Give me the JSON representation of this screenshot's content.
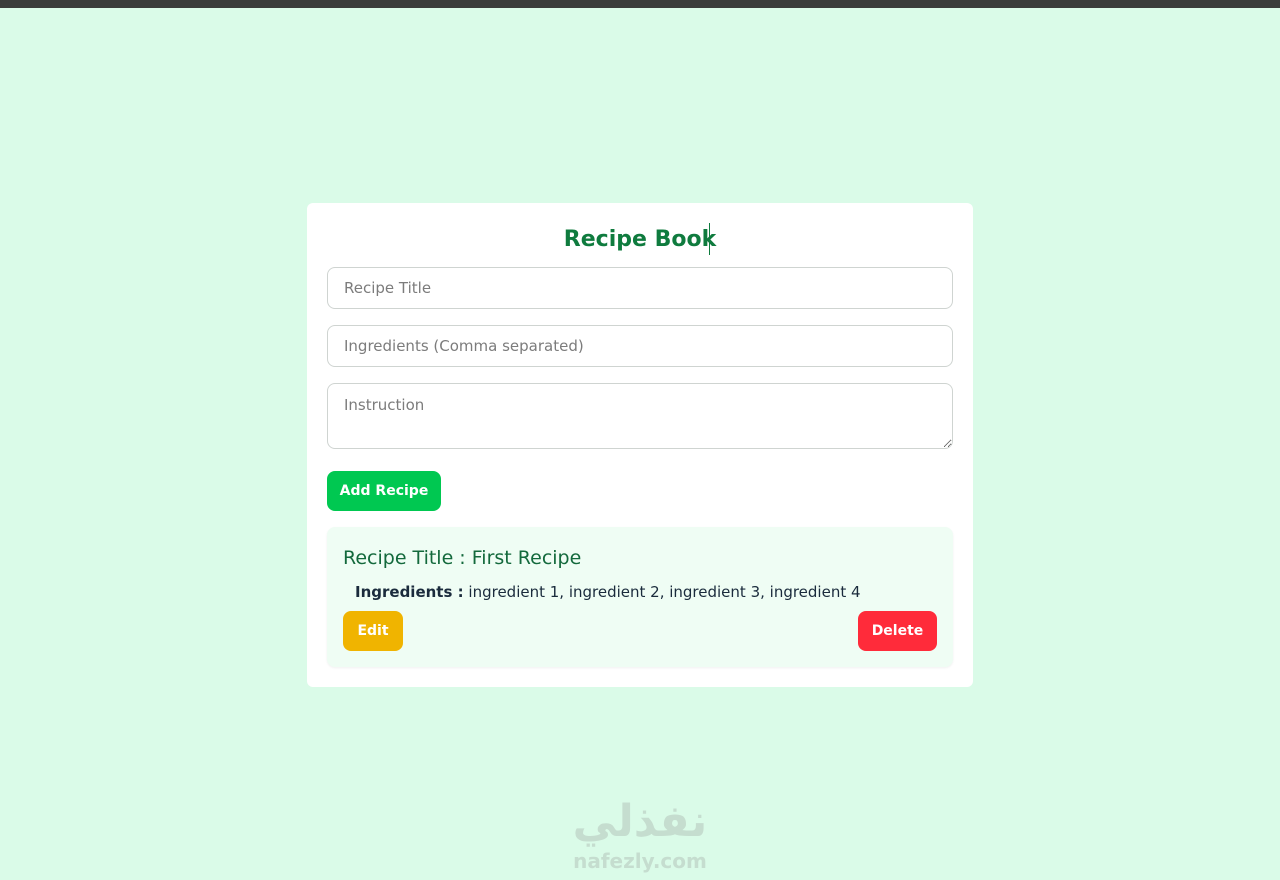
{
  "app": {
    "title": "Recipe Book"
  },
  "form": {
    "title_placeholder": "Recipe Title",
    "ingredients_placeholder": "Ingredients (Comma separated)",
    "instruction_placeholder": "Instruction",
    "add_label": "Add Recipe"
  },
  "recipes": [
    {
      "heading": "Recipe Title : First Recipe",
      "ingredients_label": "Ingredients :",
      "ingredients": "ingredient 1, ingredient 2, ingredient 3, ingredient 4",
      "edit_label": "Edit",
      "delete_label": "Delete"
    }
  ],
  "watermark": {
    "arabic": "نفذلي",
    "latin": "nafezly.com"
  },
  "colors": {
    "page_bg": "#dafbe8",
    "accent": "#0f7b3e",
    "add": "#00c851",
    "edit": "#f0b400",
    "delete": "#ff2b3a"
  }
}
